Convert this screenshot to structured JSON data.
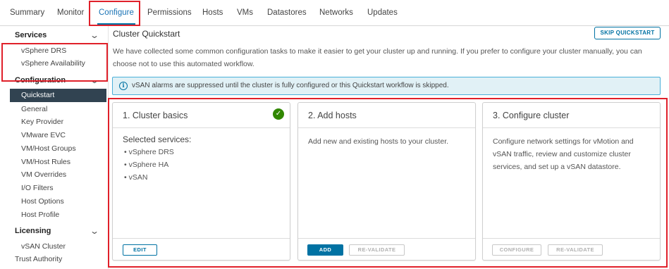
{
  "tabs": [
    "Summary",
    "Monitor",
    "Configure",
    "Permissions",
    "Hosts",
    "VMs",
    "Datastores",
    "Networks",
    "Updates"
  ],
  "sidebar": {
    "services": {
      "header": "Services",
      "items": [
        "vSphere DRS",
        "vSphere Availability"
      ]
    },
    "configuration": {
      "header": "Configuration",
      "items": [
        "Quickstart",
        "General",
        "Key Provider",
        "VMware EVC",
        "VM/Host Groups",
        "VM/Host Rules",
        "VM Overrides",
        "I/O Filters",
        "Host Options",
        "Host Profile"
      ]
    },
    "licensing": {
      "header": "Licensing",
      "items": [
        "vSAN Cluster"
      ]
    },
    "trust_authority": "Trust Authority"
  },
  "main": {
    "title": "Cluster Quickstart",
    "skip_button": "SKIP QUICKSTART",
    "intro": "We have collected some common configuration tasks to make it easier to get your cluster up and running. If you prefer to configure your cluster manually, you can choose not to use this automated workflow.",
    "alert": {
      "icon": "info-icon",
      "text": "vSAN alarms are suppressed until the cluster is fully configured or this Quickstart workflow is skipped."
    }
  },
  "cards": {
    "basics": {
      "title": "1. Cluster basics",
      "status_icon": "check-circle-icon",
      "selected_label": "Selected services:",
      "services": [
        "• vSphere DRS",
        "• vSphere HA",
        "• vSAN"
      ],
      "edit_button": "EDIT"
    },
    "hosts": {
      "title": "2. Add hosts",
      "description": "Add new and existing hosts to your cluster.",
      "add_button": "ADD",
      "revalidate_button": "RE-VALIDATE"
    },
    "configure": {
      "title": "3. Configure cluster",
      "description": "Configure network settings for vMotion and vSAN traffic, review and customize cluster services, and set up a vSAN datastore.",
      "configure_button": "CONFIGURE",
      "revalidate_button": "RE-VALIDATE"
    }
  },
  "colors": {
    "accent": "#0072a3",
    "highlight": "#e0202a",
    "selected_bg": "#314351",
    "success": "#318700",
    "alert_bg": "#e1f1f6"
  }
}
